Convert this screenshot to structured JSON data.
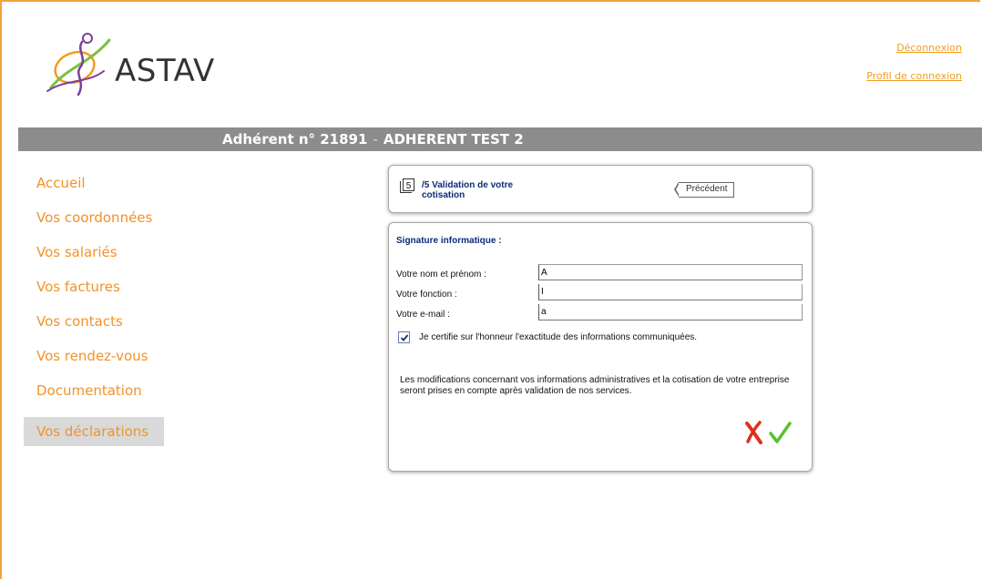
{
  "brand": {
    "name": "ASTAV"
  },
  "top_links": {
    "logout": "Déconnexion",
    "profile": "Profil de connexion"
  },
  "banner": {
    "member": "Adhérent n° 21891",
    "separator": "-",
    "company": "ADHERENT TEST 2"
  },
  "nav": {
    "items": [
      {
        "label": "Accueil"
      },
      {
        "label": "Vos coordonnées"
      },
      {
        "label": "Vos salariés"
      },
      {
        "label": "Vos factures"
      },
      {
        "label": "Vos contacts"
      },
      {
        "label": "Vos rendez-vous"
      },
      {
        "label": "Documentation"
      },
      {
        "label": "Vos déclarations",
        "active": true
      }
    ]
  },
  "step": {
    "number": "5",
    "title_line1": "/5 Validation de votre",
    "title_line2": "cotisation",
    "prev_label": "Précédent"
  },
  "signature": {
    "title": "Signature informatique :",
    "name_label": "Votre nom et prénom :",
    "name_value": "A",
    "function_label": "Votre fonction :",
    "function_value": "I",
    "email_label": "Votre e-mail :",
    "email_value": "a",
    "certify_label": "Je certifie sur l'honneur l'exactitude des informations communiquées.",
    "certify_checked": true,
    "note": "Les modifications concernant vos informations administratives et la cotisation de votre entreprise seront prises en compte après validation de nos services."
  },
  "colors": {
    "accent": "#f39c1d",
    "banner": "#8c8c8c",
    "title_blue": "#0d2a7c",
    "cancel": "#e0301e",
    "confirm": "#57c233"
  },
  "icons": {
    "cancel": "cancel-x-icon",
    "confirm": "check-icon",
    "step": "step-number-icon"
  }
}
